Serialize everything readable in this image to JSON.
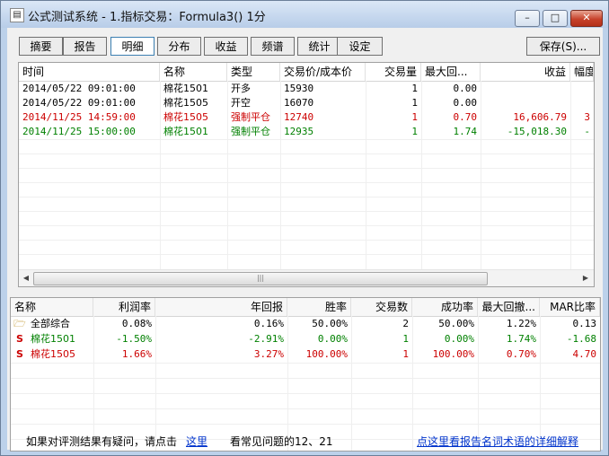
{
  "window": {
    "title": "公式测试系统 - 1.指标交易：Formula3() 1分",
    "buttons": {
      "minimize": "–",
      "maximize": "□",
      "close": "✕"
    }
  },
  "toolbar": {
    "tabs": [
      "摘要",
      "报告",
      "明细",
      "分布",
      "收益",
      "频谱",
      "统计",
      "设定"
    ],
    "active_tab": "明细",
    "save_label": "保存(S)..."
  },
  "detail_table": {
    "columns": [
      "时间",
      "名称",
      "类型",
      "交易价/成本价",
      "交易量",
      "最大回...",
      "收益",
      "幅度"
    ],
    "rows": [
      {
        "time": "2014/05/22  09:01:00",
        "name": "棉花1501",
        "type": "开多",
        "price": "15930",
        "qty": "1",
        "maxdd": "0.00",
        "profit": "",
        "pct": "",
        "color": "#000000"
      },
      {
        "time": "2014/05/22  09:01:00",
        "name": "棉花1505",
        "type": "开空",
        "price": "16070",
        "qty": "1",
        "maxdd": "0.00",
        "profit": "",
        "pct": "",
        "color": "#000000"
      },
      {
        "time": "2014/11/25  14:59:00",
        "name": "棉花1505",
        "type": "强制平仓",
        "price": "12740",
        "qty": "1",
        "maxdd": "0.70",
        "profit": "16,606.79",
        "pct": "3",
        "color": "#cc0000"
      },
      {
        "time": "2014/11/25  15:00:00",
        "name": "棉花1501",
        "type": "强制平仓",
        "price": "12935",
        "qty": "1",
        "maxdd": "1.74",
        "profit": "-15,018.30",
        "pct": "-",
        "color": "#008000"
      }
    ]
  },
  "summary_table": {
    "columns": [
      "名称",
      "利润率",
      "年回报",
      "胜率",
      "交易数",
      "成功率",
      "最大回撤...",
      "MAR比率"
    ],
    "rows": [
      {
        "icon": "folder-icon",
        "name": "全部综合",
        "profit_rate": "0.08%",
        "annual": "0.16%",
        "win": "50.00%",
        "trades": "2",
        "success": "50.00%",
        "maxdd": "1.22%",
        "mar": "0.13",
        "color": "#000000"
      },
      {
        "icon": "s-icon",
        "name": "棉花1501",
        "profit_rate": "-1.50%",
        "annual": "-2.91%",
        "win": "0.00%",
        "trades": "1",
        "success": "0.00%",
        "maxdd": "1.74%",
        "mar": "-1.68",
        "color": "#008000"
      },
      {
        "icon": "s-icon",
        "name": "棉花1505",
        "profit_rate": "1.66%",
        "annual": "3.27%",
        "win": "100.00%",
        "trades": "1",
        "success": "100.00%",
        "maxdd": "0.70%",
        "mar": "4.70",
        "color": "#cc0000"
      }
    ]
  },
  "footer": {
    "question_text": "如果对评测结果有疑问，请点击",
    "here_link": "这里",
    "faq_text": "看常见问题的12、21",
    "glossary_link": "点这里看报告名词术语的详细解释"
  },
  "colors": {
    "positive": "#cc0000",
    "negative": "#008000",
    "link": "#0033cc"
  }
}
